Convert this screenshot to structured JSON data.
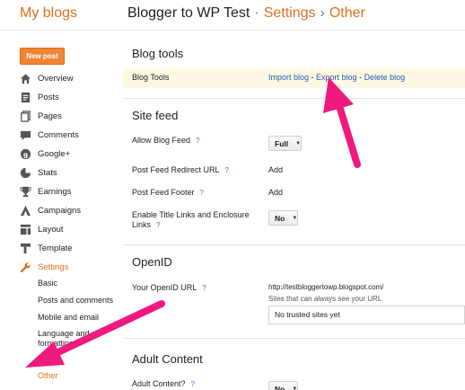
{
  "header": {
    "brand": "My blogs",
    "blog_name": "Blogger to WP Test",
    "sep": "·",
    "crumb_settings": "Settings",
    "crumb_arrow": "›",
    "crumb_current": "Other"
  },
  "sidebar": {
    "new_post_label": "New post",
    "items": [
      {
        "label": "Overview",
        "icon": "home-icon"
      },
      {
        "label": "Posts",
        "icon": "posts-icon"
      },
      {
        "label": "Pages",
        "icon": "pages-icon"
      },
      {
        "label": "Comments",
        "icon": "comments-icon"
      },
      {
        "label": "Google+",
        "icon": "google-plus-icon"
      },
      {
        "label": "Stats",
        "icon": "stats-icon"
      },
      {
        "label": "Earnings",
        "icon": "trophy-icon"
      },
      {
        "label": "Campaigns",
        "icon": "campaigns-icon"
      },
      {
        "label": "Layout",
        "icon": "layout-icon"
      },
      {
        "label": "Template",
        "icon": "template-icon"
      },
      {
        "label": "Settings",
        "icon": "wrench-icon"
      }
    ],
    "sub_items": [
      "Basic",
      "Posts and comments",
      "Mobile and email",
      "Language and formatting",
      "Other"
    ]
  },
  "main": {
    "blog_tools": {
      "title": "Blog tools",
      "row_label": "Blog Tools",
      "import_label": "Import blog",
      "export_label": "Export blog",
      "delete_label": "Delete blog",
      "dash": " - "
    },
    "site_feed": {
      "title": "Site feed",
      "allow_label": "Allow Blog Feed",
      "allow_value": "Full",
      "redirect_label": "Post Feed Redirect URL",
      "redirect_add": "Add",
      "footer_label": "Post Feed Footer",
      "footer_add": "Add",
      "title_links_label": "Enable Title Links and Enclosure Links",
      "title_links_value": "No",
      "help": "?"
    },
    "openid": {
      "title": "OpenID",
      "url_label": "Your OpenID URL",
      "url_value": "http://testbloggertowp.blogspot.com/",
      "sites_note": "Sites that can always see your URL",
      "trusted_value": "No trusted sites yet"
    },
    "adult": {
      "title": "Adult Content",
      "label": "Adult Content?",
      "value": "No"
    }
  },
  "colors": {
    "accent_orange": "#e26e1f",
    "link_blue": "#2a57b8",
    "annotation_pink": "#f0197d"
  }
}
